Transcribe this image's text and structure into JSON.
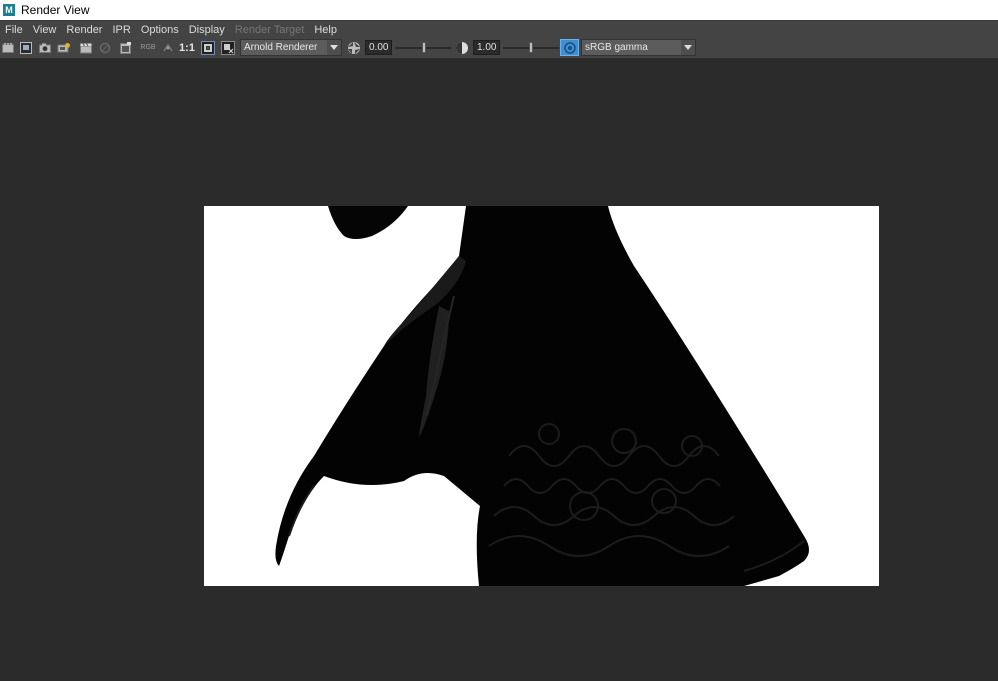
{
  "window": {
    "title": "Render View",
    "logo_letter": "M"
  },
  "menu": [
    "File",
    "View",
    "Render",
    "IPR",
    "Options",
    "Display",
    "Render Target",
    "Help"
  ],
  "menu_disabled": [
    "Render Target"
  ],
  "toolbar": {
    "ratio_label": "1:1",
    "rgb_label": "RGB",
    "renderer": "Arnold Renderer",
    "exposure_value": "0.00",
    "gamma_value": "1.00",
    "exposure_slider_fraction": 0.52,
    "gamma_slider_fraction": 0.5,
    "color_space": "sRGB gamma"
  },
  "colors": {
    "background": "#2b2b2b",
    "panel": "#444444",
    "accent": "#3d8fd6"
  }
}
